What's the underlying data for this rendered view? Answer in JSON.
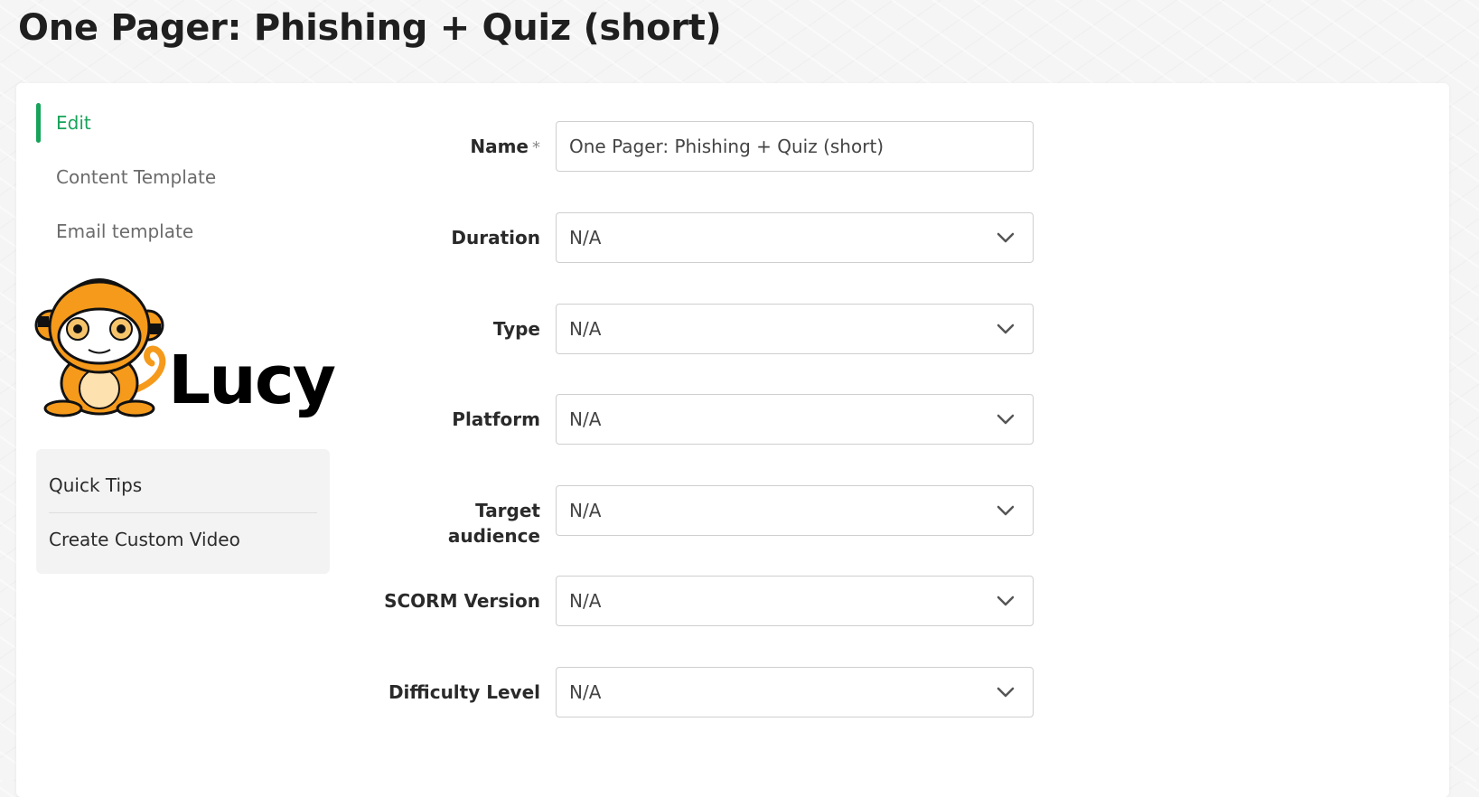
{
  "page": {
    "title": "One Pager: Phishing + Quiz (short)"
  },
  "sidebar": {
    "nav": [
      {
        "label": "Edit",
        "active": true
      },
      {
        "label": "Content Template",
        "active": false
      },
      {
        "label": "Email template",
        "active": false
      }
    ],
    "logo_text": "Lucy",
    "tips": [
      {
        "label": "Quick Tips"
      },
      {
        "label": "Create Custom Video"
      }
    ]
  },
  "form": {
    "name": {
      "label": "Name",
      "required_mark": "*",
      "value": "One Pager: Phishing + Quiz (short)"
    },
    "duration": {
      "label": "Duration",
      "value": "N/A"
    },
    "type": {
      "label": "Type",
      "value": "N/A"
    },
    "platform": {
      "label": "Platform",
      "value": "N/A"
    },
    "target_audience": {
      "label_line1": "Target",
      "label_line2": "audience",
      "value": "N/A"
    },
    "scorm_version": {
      "label": "SCORM Version",
      "value": "N/A"
    },
    "difficulty_level": {
      "label": "Difficulty Level",
      "value": "N/A"
    }
  },
  "colors": {
    "accent": "#17a35a",
    "logo_orange": "#f59a1b"
  }
}
